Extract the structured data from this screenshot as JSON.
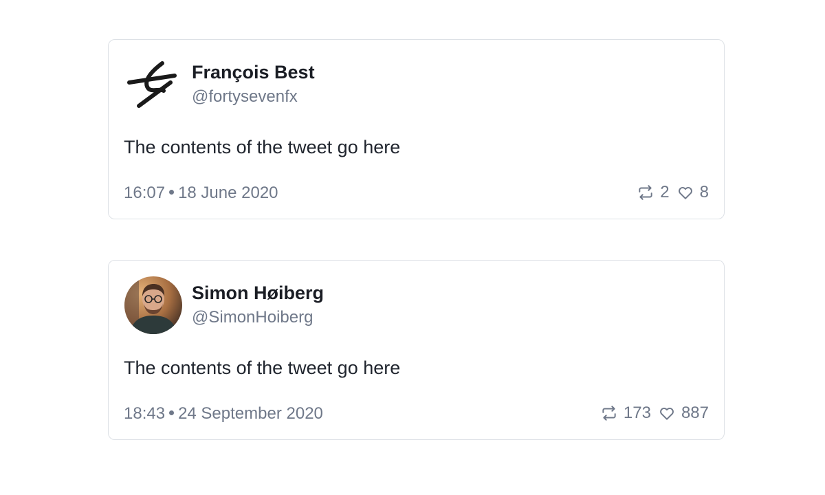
{
  "tweets": [
    {
      "name": "François Best",
      "handle": "@fortysevenfx",
      "content": "The contents of the tweet go here",
      "time": "16:07",
      "date": "18 June 2020",
      "retweets": "2",
      "likes": "8",
      "avatar_icon": "logo-icon"
    },
    {
      "name": "Simon Høiberg",
      "handle": "@SimonHoiberg",
      "content": "The contents of the tweet go here",
      "time": "18:43",
      "date": "24 September 2020",
      "retweets": "173",
      "likes": "887",
      "avatar_icon": "profile-photo"
    }
  ],
  "icons": {
    "retweet": "retweet-icon",
    "like": "heart-icon"
  },
  "colors": {
    "border": "#dde1e6",
    "name": "#1a1d24",
    "muted": "#6f7889",
    "text": "#1f242d"
  }
}
